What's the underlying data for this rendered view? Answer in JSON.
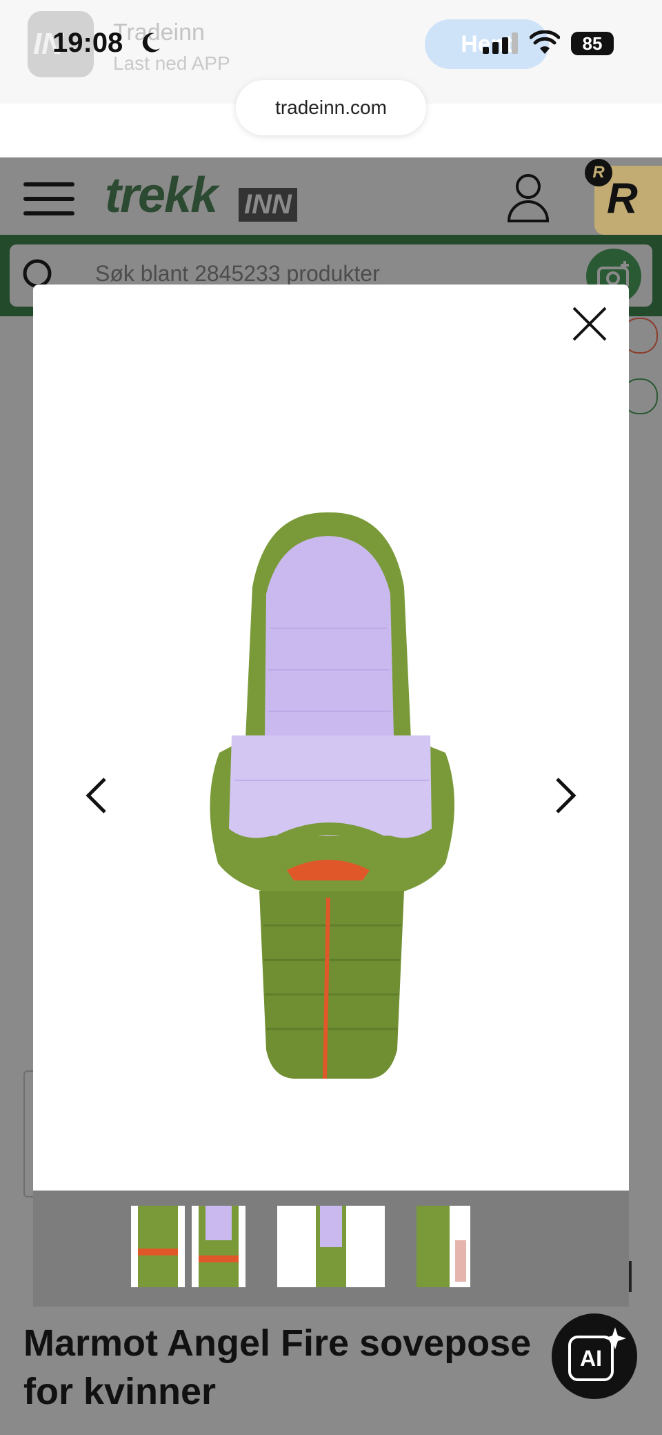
{
  "status_bar": {
    "time": "19:08",
    "battery": "85",
    "banner_app_name": "Tradeinn",
    "banner_app_sub": "Last ned APP",
    "banner_app_icon_text": "IN",
    "banner_open_label": "Hent"
  },
  "browser": {
    "url": "tradeinn.com"
  },
  "header": {
    "logo_main": "trekk",
    "logo_suffix": "INN",
    "rewards_letter": "R",
    "rewards_badge_letter": "R"
  },
  "search": {
    "placeholder": "Søk blant 2845233 produkter"
  },
  "product": {
    "title": "Marmot Angel Fire sovepose for kvinner"
  },
  "ai_button": {
    "label": "AI"
  },
  "colors": {
    "brand_green": "#244a2c",
    "bag_green": "#7a9a3a",
    "liner_lilac": "#c9b9ee",
    "zip_orange": "#e0582a",
    "overlay": "#8a8a8a"
  },
  "gallery": {
    "thumbnail_count": 4
  }
}
